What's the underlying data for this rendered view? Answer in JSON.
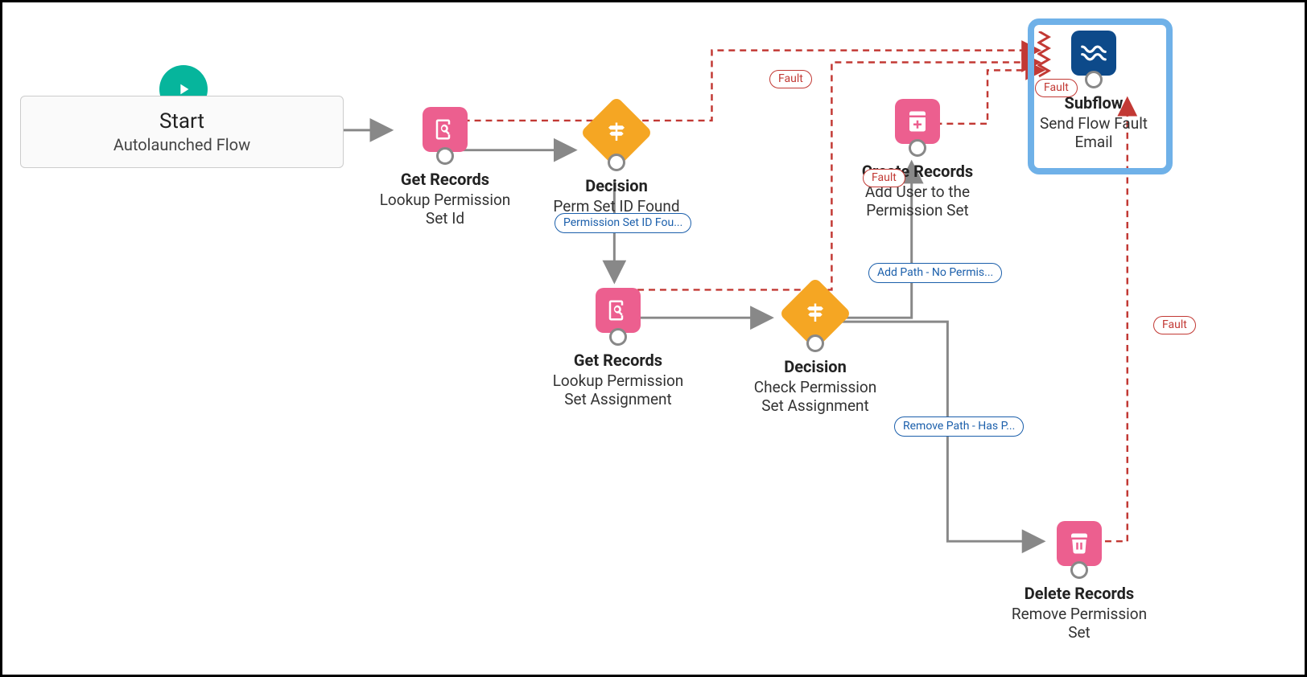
{
  "colors": {
    "pink": "#ec5f8f",
    "orange": "#f5a623",
    "blue": "#0d4a8a",
    "teal": "#06b59c",
    "fault": "#c23934",
    "link": "#1b5fab",
    "highlight": "#6fb1e8"
  },
  "start": {
    "title": "Start",
    "subtitle": "Autolaunched Flow"
  },
  "nodes": {
    "getRecords1": {
      "type": "Get Records",
      "label": "Lookup Permission Set Id",
      "icon": "search"
    },
    "decision1": {
      "type": "Decision",
      "label": "Perm Set ID Found",
      "icon": "signpost",
      "outcome_pill": "Permission Set ID Fou..."
    },
    "getRecords2": {
      "type": "Get Records",
      "label": "Lookup Permission Set Assignment",
      "icon": "search"
    },
    "decision2": {
      "type": "Decision",
      "label": "Check Permission Set Assignment",
      "icon": "signpost",
      "outcome_pill_add": "Add Path - No Permis...",
      "outcome_pill_remove": "Remove Path - Has P..."
    },
    "createRecords": {
      "type": "Create Records",
      "label": "Add User to the Permission Set",
      "icon": "plus"
    },
    "deleteRecords": {
      "type": "Delete Records",
      "label": "Remove Permission Set",
      "icon": "trash"
    },
    "subflow": {
      "type": "Subflow",
      "label": "Send Flow Fault Email",
      "icon": "flow"
    }
  },
  "fault_label": "Fault"
}
